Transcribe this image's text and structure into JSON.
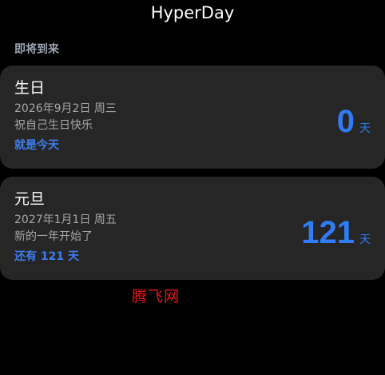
{
  "app": {
    "title": "HyperDay"
  },
  "section": {
    "title": "即将到来"
  },
  "events": [
    {
      "name": "生日",
      "date": "2026年9月2日 周三",
      "note": "祝自己生日快乐",
      "status": "就是今天",
      "days": "0",
      "unit": "天"
    },
    {
      "name": "元旦",
      "date": "2027年1月1日 周五",
      "note": "新的一年开始了",
      "status": "还有 121 天",
      "days": "121",
      "unit": "天"
    }
  ],
  "watermark": {
    "text": "腾飞网"
  },
  "colors": {
    "background": "#000000",
    "card": "#262626",
    "accent": "#2f7cf6",
    "secondary_text": "#a6a6a6",
    "section_text": "#9da3b4",
    "watermark": "#e01919"
  }
}
